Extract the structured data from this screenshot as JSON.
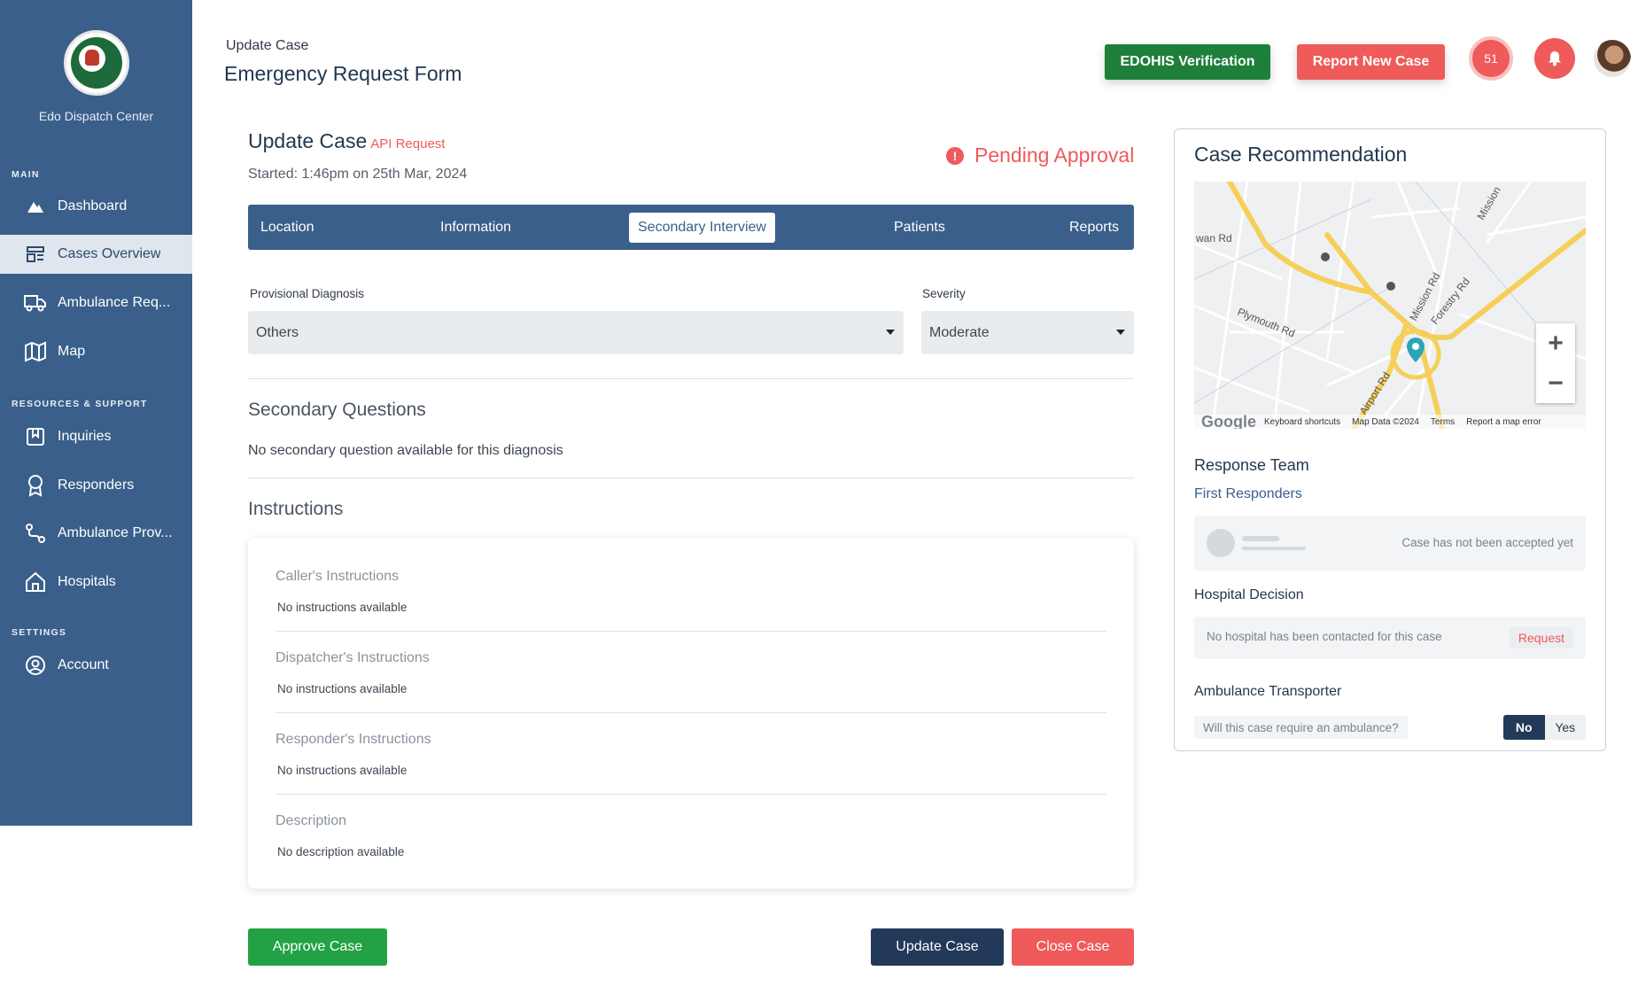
{
  "sidebar": {
    "center_name": "Edo Dispatch Center",
    "sections": {
      "main": "MAIN",
      "resources": "RESOURCES & SUPPORT",
      "settings": "SETTINGS"
    },
    "items": [
      {
        "label": "Dashboard",
        "icon": "dashboard-icon",
        "active": false
      },
      {
        "label": "Cases Overview",
        "icon": "cases-icon",
        "active": true
      },
      {
        "label": "Ambulance Req...",
        "icon": "truck-icon",
        "active": false
      },
      {
        "label": "Map",
        "icon": "map-icon",
        "active": false
      },
      {
        "label": "Inquiries",
        "icon": "bookmark-icon",
        "active": false
      },
      {
        "label": "Responders",
        "icon": "badge-icon",
        "active": false
      },
      {
        "label": "Ambulance Prov...",
        "icon": "route-icon",
        "active": false
      },
      {
        "label": "Hospitals",
        "icon": "home-icon",
        "active": false
      },
      {
        "label": "Account",
        "icon": "user-circle-icon",
        "active": false
      }
    ]
  },
  "header": {
    "breadcrumb": "Update Case",
    "title": "Emergency Request Form",
    "verify_button": "EDOHIS Verification",
    "report_button": "Report New Case",
    "notification_count": "51"
  },
  "case": {
    "title": "Update Case",
    "source_tag": "API Request",
    "started": "Started: 1:46pm on 25th Mar, 2024",
    "status": "Pending Approval"
  },
  "tabs": [
    "Location",
    "Information",
    "Secondary Interview",
    "Patients",
    "Reports"
  ],
  "form": {
    "diagnosis_label": "Provisional Diagnosis",
    "diagnosis_value": "Others",
    "severity_label": "Severity",
    "severity_value": "Moderate"
  },
  "secondary": {
    "title": "Secondary Questions",
    "empty": "No secondary question available for this diagnosis"
  },
  "instructions": {
    "title": "Instructions",
    "items": [
      {
        "heading": "Caller's Instructions",
        "body": "No instructions available"
      },
      {
        "heading": "Dispatcher's Instructions",
        "body": "No instructions available"
      },
      {
        "heading": "Responder's Instructions",
        "body": "No instructions available"
      },
      {
        "heading": "Description",
        "body": "No description available"
      }
    ]
  },
  "actions": {
    "approve": "Approve Case",
    "update": "Update Case",
    "close": "Close Case"
  },
  "recommendation": {
    "title": "Case Recommendation",
    "map": {
      "roads": [
        "wan Rd",
        "Plymouth Rd",
        "Mission Rd",
        "Forestry Rd",
        "Airport Rd",
        "Mission"
      ],
      "footer": [
        "Keyboard shortcuts",
        "Map Data ©2024",
        "Terms",
        "Report a map error"
      ],
      "brand": "Google"
    },
    "response_team": "Response Team",
    "first_responders": "First Responders",
    "not_accepted": "Case has not been accepted yet",
    "hospital_decision": "Hospital Decision",
    "no_hospital": "No hospital has been contacted for this case",
    "request": "Request",
    "ambulance_transporter": "Ambulance Transporter",
    "ambulance_question": "Will this case require an ambulance?",
    "toggle_no": "No",
    "toggle_yes": "Yes"
  },
  "colors": {
    "sidebar": "#3a5f8a",
    "accent_red": "#ef5a5a",
    "verify_green": "#1e7f3a",
    "approve_green": "#22a244",
    "dark_navy": "#22395a"
  }
}
